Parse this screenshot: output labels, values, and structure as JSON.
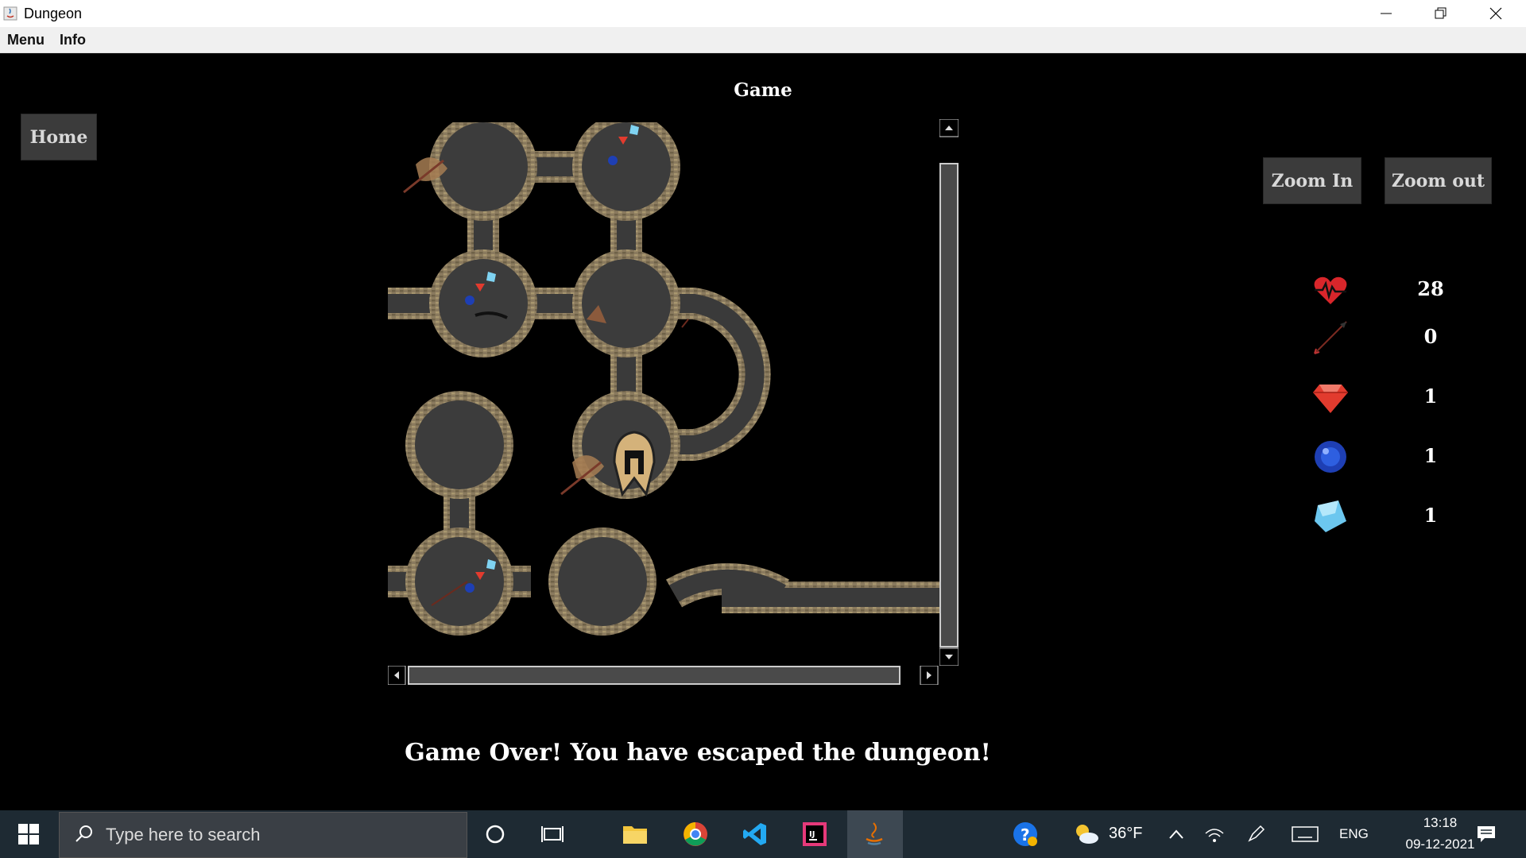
{
  "window": {
    "title": "Dungeon"
  },
  "menubar": {
    "items": [
      "Menu",
      "Info"
    ]
  },
  "game": {
    "title": "Game",
    "home_label": "Home",
    "zoom_in_label": "Zoom In",
    "zoom_out_label": "Zoom out",
    "status_message": "Game Over! You have escaped the dungeon!"
  },
  "stats": [
    {
      "icon": "health-heart-icon",
      "value": "28"
    },
    {
      "icon": "arrow-icon",
      "value": "0"
    },
    {
      "icon": "ruby-icon",
      "value": "1"
    },
    {
      "icon": "sapphire-icon",
      "value": "1"
    },
    {
      "icon": "diamond-icon",
      "value": "1"
    }
  ],
  "taskbar": {
    "search_placeholder": "Type here to search",
    "weather": "36°F",
    "language": "ENG",
    "time": "13:18",
    "date": "09-12-2021"
  },
  "colors": {
    "background": "#000000",
    "button_bg": "#3b3b3b",
    "button_text": "#d8d8d8",
    "taskbar": "#1e2a33"
  }
}
